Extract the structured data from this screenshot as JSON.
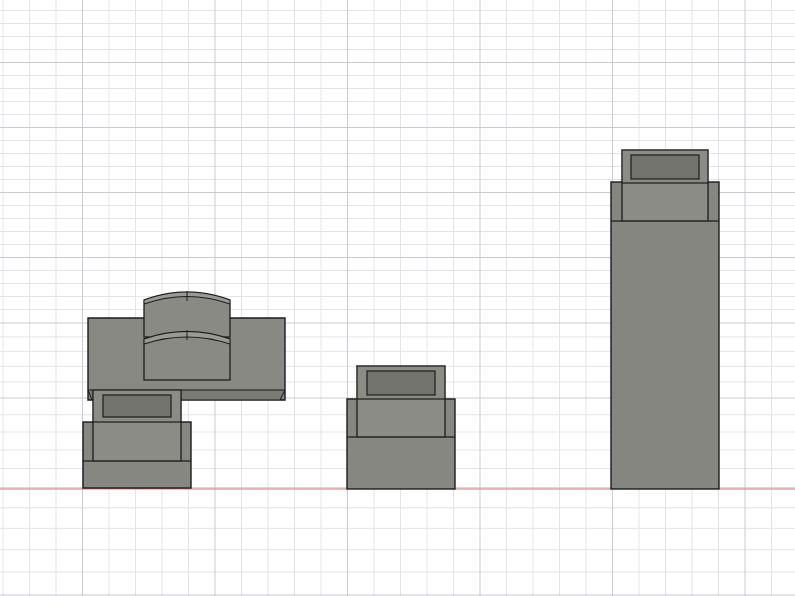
{
  "viewport": {
    "background_color": "#ffffff",
    "minor_grid_color": "#e3e4e8",
    "major_grid_color": "#c9cbd2",
    "axis_color": "#e07a7a"
  },
  "model": {
    "body_color": "#8a8a84",
    "face_color": "#7d7d77",
    "inset_color": "#6e6e68",
    "edge_color": "#1b1b1b",
    "objects": [
      {
        "name": "flat-plate-with-curved-blocks"
      },
      {
        "name": "small-stepped-block-left"
      },
      {
        "name": "stepped-block-middle"
      },
      {
        "name": "tall-column-right"
      }
    ]
  }
}
